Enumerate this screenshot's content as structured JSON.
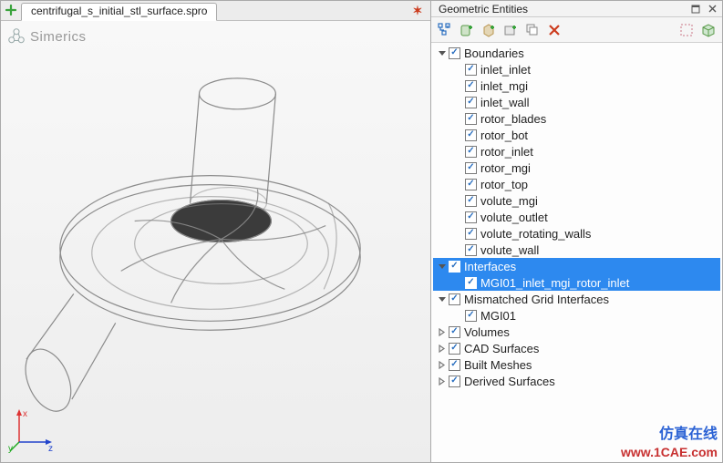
{
  "tab": {
    "filename": "centrifugal_s_initial_stl_surface.spro"
  },
  "brand": "Simerics",
  "panel": {
    "title": "Geometric Entities"
  },
  "axis": {
    "x": "x",
    "y": "y",
    "z": "z"
  },
  "watermark1": "仿真在线",
  "watermark2": "www.1CAE.com",
  "tree": [
    {
      "id": "boundaries",
      "label": "Boundaries",
      "depth": 0,
      "expandState": "open",
      "checked": true,
      "selected": false
    },
    {
      "id": "inlet_inlet",
      "label": "inlet_inlet",
      "depth": 1,
      "expandState": "none",
      "checked": true,
      "selected": false
    },
    {
      "id": "inlet_mgi",
      "label": "inlet_mgi",
      "depth": 1,
      "expandState": "none",
      "checked": true,
      "selected": false
    },
    {
      "id": "inlet_wall",
      "label": "inlet_wall",
      "depth": 1,
      "expandState": "none",
      "checked": true,
      "selected": false
    },
    {
      "id": "rotor_blades",
      "label": "rotor_blades",
      "depth": 1,
      "expandState": "none",
      "checked": true,
      "selected": false
    },
    {
      "id": "rotor_bot",
      "label": "rotor_bot",
      "depth": 1,
      "expandState": "none",
      "checked": true,
      "selected": false
    },
    {
      "id": "rotor_inlet",
      "label": "rotor_inlet",
      "depth": 1,
      "expandState": "none",
      "checked": true,
      "selected": false
    },
    {
      "id": "rotor_mgi",
      "label": "rotor_mgi",
      "depth": 1,
      "expandState": "none",
      "checked": true,
      "selected": false
    },
    {
      "id": "rotor_top",
      "label": "rotor_top",
      "depth": 1,
      "expandState": "none",
      "checked": true,
      "selected": false
    },
    {
      "id": "volute_mgi",
      "label": "volute_mgi",
      "depth": 1,
      "expandState": "none",
      "checked": true,
      "selected": false
    },
    {
      "id": "volute_outlet",
      "label": "volute_outlet",
      "depth": 1,
      "expandState": "none",
      "checked": true,
      "selected": false
    },
    {
      "id": "volute_rotating_walls",
      "label": "volute_rotating_walls",
      "depth": 1,
      "expandState": "none",
      "checked": true,
      "selected": false
    },
    {
      "id": "volute_wall",
      "label": "volute_wall",
      "depth": 1,
      "expandState": "none",
      "checked": true,
      "selected": false
    },
    {
      "id": "interfaces",
      "label": "Interfaces",
      "depth": 0,
      "expandState": "open",
      "checked": true,
      "selected": true
    },
    {
      "id": "mgi01_inlet",
      "label": "MGI01_inlet_mgi_rotor_inlet",
      "depth": 1,
      "expandState": "none",
      "checked": true,
      "selected": true
    },
    {
      "id": "mismatched",
      "label": "Mismatched Grid Interfaces",
      "depth": 0,
      "expandState": "open",
      "checked": true,
      "selected": false
    },
    {
      "id": "mgi01",
      "label": "MGI01",
      "depth": 1,
      "expandState": "none",
      "checked": true,
      "selected": false
    },
    {
      "id": "volumes",
      "label": "Volumes",
      "depth": 0,
      "expandState": "closed",
      "checked": true,
      "selected": false
    },
    {
      "id": "cad_surfaces",
      "label": "CAD Surfaces",
      "depth": 0,
      "expandState": "closed",
      "checked": true,
      "selected": false
    },
    {
      "id": "built_meshes",
      "label": "Built Meshes",
      "depth": 0,
      "expandState": "closed",
      "checked": true,
      "selected": false
    },
    {
      "id": "derived_surfaces",
      "label": "Derived Surfaces",
      "depth": 0,
      "expandState": "closed",
      "checked": true,
      "selected": false
    }
  ]
}
